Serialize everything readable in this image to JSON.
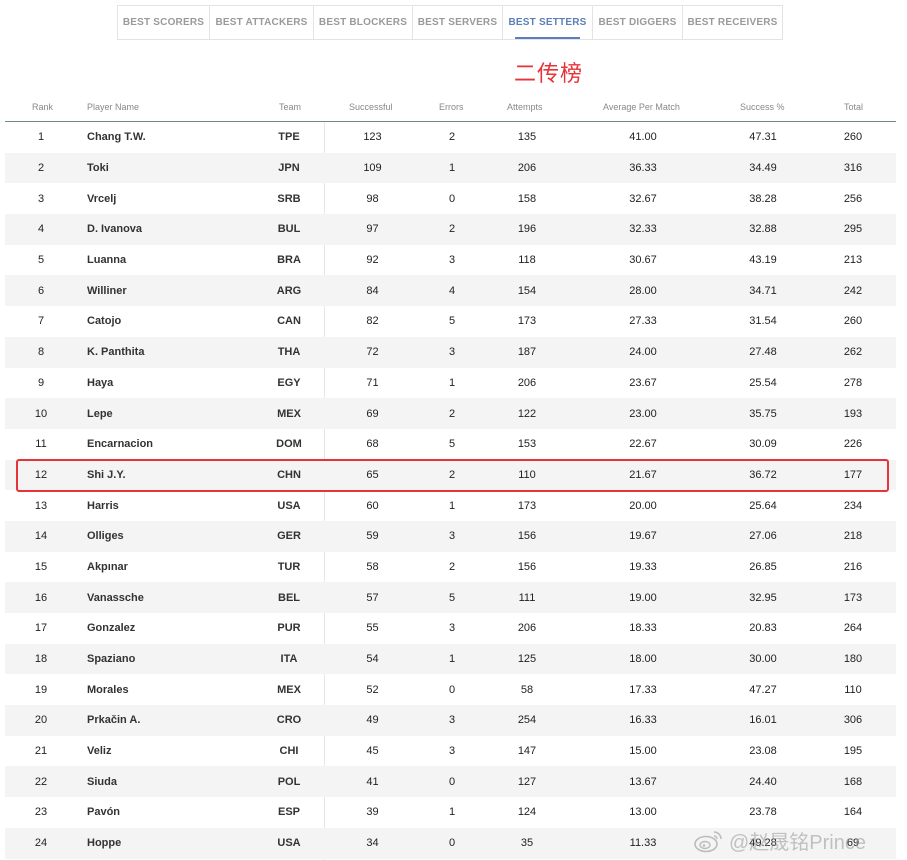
{
  "tabs": [
    {
      "label": "BEST SCORERS",
      "active": false
    },
    {
      "label": "BEST ATTACKERS",
      "active": false
    },
    {
      "label": "BEST BLOCKERS",
      "active": false
    },
    {
      "label": "BEST SERVERS",
      "active": false
    },
    {
      "label": "BEST SETTERS",
      "active": true
    },
    {
      "label": "BEST DIGGERS",
      "active": false
    },
    {
      "label": "BEST RECEIVERS",
      "active": false
    }
  ],
  "annotation": {
    "title": "二传榜",
    "color": "#e8323a"
  },
  "table": {
    "headers": {
      "rank": "Rank",
      "name": "Player Name",
      "team": "Team",
      "successful": "Successful",
      "errors": "Errors",
      "attempts": "Attempts",
      "avg": "Average Per Match",
      "pct": "Success %",
      "total": "Total"
    },
    "highlighted_rank": "12",
    "rows": [
      {
        "rank": "1",
        "name": "Chang T.W.",
        "team": "TPE",
        "successful": "123",
        "errors": "2",
        "attempts": "135",
        "avg": "41.00",
        "pct": "47.31",
        "total": "260"
      },
      {
        "rank": "2",
        "name": "Toki",
        "team": "JPN",
        "successful": "109",
        "errors": "1",
        "attempts": "206",
        "avg": "36.33",
        "pct": "34.49",
        "total": "316"
      },
      {
        "rank": "3",
        "name": "Vrcelj",
        "team": "SRB",
        "successful": "98",
        "errors": "0",
        "attempts": "158",
        "avg": "32.67",
        "pct": "38.28",
        "total": "256"
      },
      {
        "rank": "4",
        "name": "D. Ivanova",
        "team": "BUL",
        "successful": "97",
        "errors": "2",
        "attempts": "196",
        "avg": "32.33",
        "pct": "32.88",
        "total": "295"
      },
      {
        "rank": "5",
        "name": "Luanna",
        "team": "BRA",
        "successful": "92",
        "errors": "3",
        "attempts": "118",
        "avg": "30.67",
        "pct": "43.19",
        "total": "213"
      },
      {
        "rank": "6",
        "name": "Williner",
        "team": "ARG",
        "successful": "84",
        "errors": "4",
        "attempts": "154",
        "avg": "28.00",
        "pct": "34.71",
        "total": "242"
      },
      {
        "rank": "7",
        "name": "Catojo",
        "team": "CAN",
        "successful": "82",
        "errors": "5",
        "attempts": "173",
        "avg": "27.33",
        "pct": "31.54",
        "total": "260"
      },
      {
        "rank": "8",
        "name": "K. Panthita",
        "team": "THA",
        "successful": "72",
        "errors": "3",
        "attempts": "187",
        "avg": "24.00",
        "pct": "27.48",
        "total": "262"
      },
      {
        "rank": "9",
        "name": "Haya",
        "team": "EGY",
        "successful": "71",
        "errors": "1",
        "attempts": "206",
        "avg": "23.67",
        "pct": "25.54",
        "total": "278"
      },
      {
        "rank": "10",
        "name": "Lepe",
        "team": "MEX",
        "successful": "69",
        "errors": "2",
        "attempts": "122",
        "avg": "23.00",
        "pct": "35.75",
        "total": "193"
      },
      {
        "rank": "11",
        "name": "Encarnacion",
        "team": "DOM",
        "successful": "68",
        "errors": "5",
        "attempts": "153",
        "avg": "22.67",
        "pct": "30.09",
        "total": "226"
      },
      {
        "rank": "12",
        "name": "Shi J.Y.",
        "team": "CHN",
        "successful": "65",
        "errors": "2",
        "attempts": "110",
        "avg": "21.67",
        "pct": "36.72",
        "total": "177"
      },
      {
        "rank": "13",
        "name": "Harris",
        "team": "USA",
        "successful": "60",
        "errors": "1",
        "attempts": "173",
        "avg": "20.00",
        "pct": "25.64",
        "total": "234"
      },
      {
        "rank": "14",
        "name": "Olliges",
        "team": "GER",
        "successful": "59",
        "errors": "3",
        "attempts": "156",
        "avg": "19.67",
        "pct": "27.06",
        "total": "218"
      },
      {
        "rank": "15",
        "name": "Akpınar",
        "team": "TUR",
        "successful": "58",
        "errors": "2",
        "attempts": "156",
        "avg": "19.33",
        "pct": "26.85",
        "total": "216"
      },
      {
        "rank": "16",
        "name": "Vanassche",
        "team": "BEL",
        "successful": "57",
        "errors": "5",
        "attempts": "111",
        "avg": "19.00",
        "pct": "32.95",
        "total": "173"
      },
      {
        "rank": "17",
        "name": "Gonzalez",
        "team": "PUR",
        "successful": "55",
        "errors": "3",
        "attempts": "206",
        "avg": "18.33",
        "pct": "20.83",
        "total": "264"
      },
      {
        "rank": "18",
        "name": "Spaziano",
        "team": "ITA",
        "successful": "54",
        "errors": "1",
        "attempts": "125",
        "avg": "18.00",
        "pct": "30.00",
        "total": "180"
      },
      {
        "rank": "19",
        "name": "Morales",
        "team": "MEX",
        "successful": "52",
        "errors": "0",
        "attempts": "58",
        "avg": "17.33",
        "pct": "47.27",
        "total": "110"
      },
      {
        "rank": "20",
        "name": "Prkačin A.",
        "team": "CRO",
        "successful": "49",
        "errors": "3",
        "attempts": "254",
        "avg": "16.33",
        "pct": "16.01",
        "total": "306"
      },
      {
        "rank": "21",
        "name": "Veliz",
        "team": "CHI",
        "successful": "45",
        "errors": "3",
        "attempts": "147",
        "avg": "15.00",
        "pct": "23.08",
        "total": "195"
      },
      {
        "rank": "22",
        "name": "Siuda",
        "team": "POL",
        "successful": "41",
        "errors": "0",
        "attempts": "127",
        "avg": "13.67",
        "pct": "24.40",
        "total": "168"
      },
      {
        "rank": "23",
        "name": "Pavón",
        "team": "ESP",
        "successful": "39",
        "errors": "1",
        "attempts": "124",
        "avg": "13.00",
        "pct": "23.78",
        "total": "164"
      },
      {
        "rank": "24",
        "name": "Hoppe",
        "team": "USA",
        "successful": "34",
        "errors": "0",
        "attempts": "35",
        "avg": "11.33",
        "pct": "49.28",
        "total": "69"
      }
    ]
  },
  "watermark": {
    "text": "@赵晟铭Prince",
    "icon": "weibo-icon"
  }
}
